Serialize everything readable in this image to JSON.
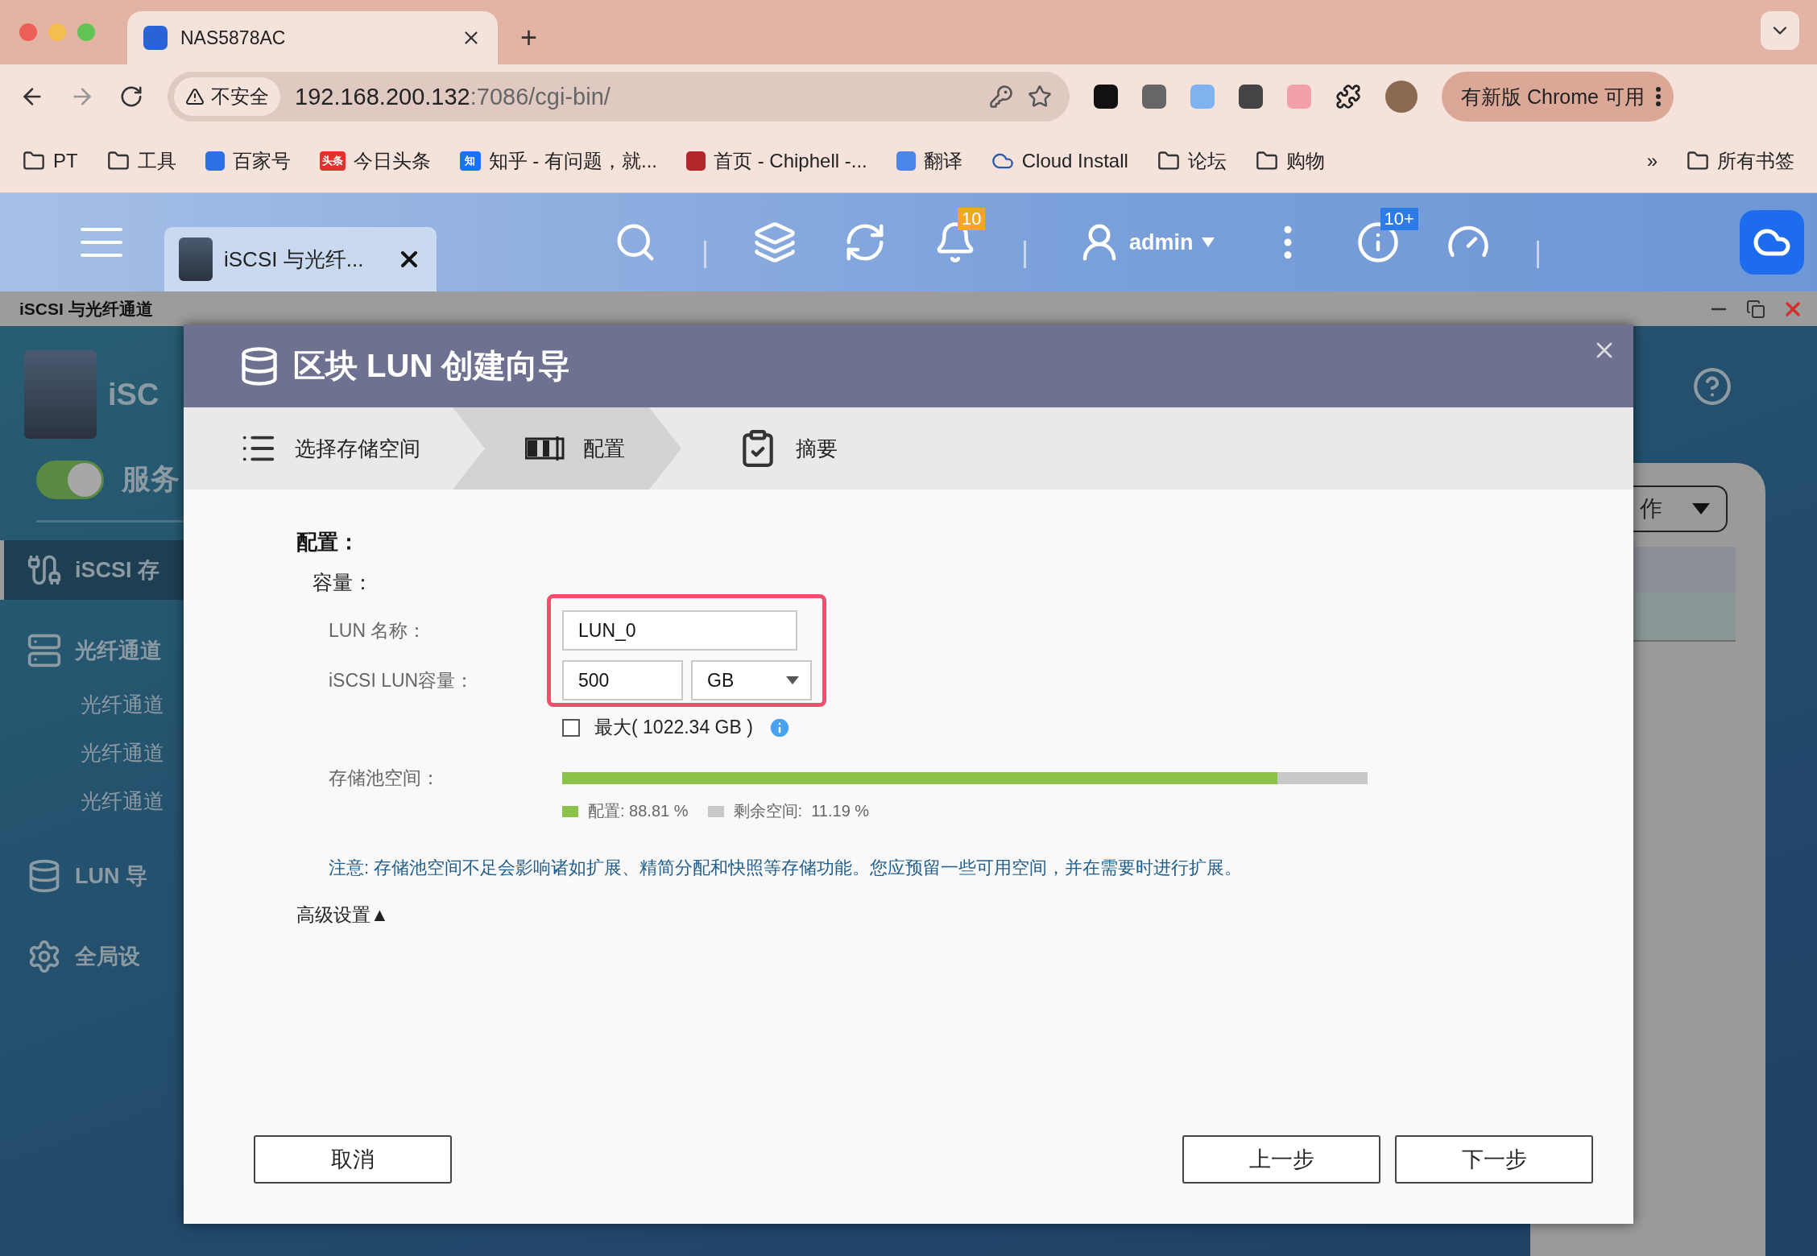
{
  "browser": {
    "tab": {
      "title": "NAS5878AC"
    },
    "new_tab": "+",
    "address": {
      "security": "不安全",
      "host": "192.168.200.132",
      "path": ":7086/cgi-bin/"
    },
    "update_button": "有新版 Chrome 可用",
    "bookmarks": [
      {
        "kind": "folder",
        "label": "PT"
      },
      {
        "kind": "folder",
        "label": "工具"
      },
      {
        "kind": "site",
        "label": "百家号",
        "color": "#2f6fe4"
      },
      {
        "kind": "badge",
        "label": "今日头条",
        "badge": "头条",
        "color": "#e0322c"
      },
      {
        "kind": "badge",
        "label": "知乎 - 有问题，就...",
        "badge": "知",
        "color": "#1772f6"
      },
      {
        "kind": "site",
        "label": "首页 - Chiphell -...",
        "color": "#b3262a"
      },
      {
        "kind": "site",
        "label": "翻译",
        "color": "#4a86e8"
      },
      {
        "kind": "cloud",
        "label": "Cloud Install",
        "color": "#2b5aa8"
      },
      {
        "kind": "folder",
        "label": "论坛"
      },
      {
        "kind": "folder",
        "label": "购物"
      }
    ],
    "more": "»",
    "all_bookmarks": "所有书签"
  },
  "nas_header": {
    "app_tab": {
      "title": "iSCSI 与光纤..."
    },
    "bell_badge": "10",
    "info_badge": "10+",
    "user": "admin"
  },
  "window": {
    "title": "iSCSI 与光纤通道"
  },
  "sidebar": {
    "app_title": "iSC",
    "service": {
      "label": "服务",
      "on": true
    },
    "items": [
      {
        "kind": "iscsi",
        "label": "iSCSI 存",
        "selected": true
      },
      {
        "kind": "fibre",
        "label": "光纤通道",
        "selected": false,
        "children": [
          {
            "label": "光纤通道",
            "selected": false
          },
          {
            "label": "光纤通道",
            "selected": false
          },
          {
            "label": "光纤通道",
            "selected": false
          }
        ]
      },
      {
        "kind": "import",
        "label": "LUN 导",
        "selected": false
      },
      {
        "kind": "settings",
        "label": "全局设",
        "selected": false
      }
    ]
  },
  "background": {
    "dropdown": "作"
  },
  "dialog": {
    "title": "区块 LUN 创建向导",
    "steps": [
      {
        "kind": "list",
        "label": "选择存储空间",
        "selected": false
      },
      {
        "kind": "config",
        "label": "配置",
        "selected": true
      },
      {
        "kind": "summary",
        "label": "摘要",
        "selected": false
      }
    ],
    "section": "配置：",
    "group": "容量：",
    "highlight": true,
    "lun_name": {
      "label": "LUN 名称：",
      "value": "LUN_0"
    },
    "capacity": {
      "label": "iSCSI LUN容量：",
      "value": "500",
      "unit": "GB"
    },
    "max": {
      "label": "最大( 1022.34 GB )",
      "checked": false
    },
    "pool": {
      "label": "存储池空间：",
      "level": 0.8881,
      "legend": [
        {
          "label": "配置: 88.81 %",
          "color": "#8bc34a"
        },
        {
          "label": "剩余空间:  11.19 %",
          "color": "#c8c8c8"
        }
      ]
    },
    "note": "注意: 存储池空间不足会影响诸如扩展、精简分配和快照等存储功能。您应预留一些可用空间，并在需要时进行扩展。",
    "advanced": "高级设置▲",
    "buttons": {
      "cancel": "取消",
      "prev": "上一步",
      "next": "下一步"
    }
  }
}
